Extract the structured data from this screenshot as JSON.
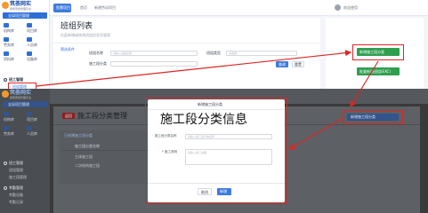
{
  "top": {
    "brand": {
      "name": "筑荟网实",
      "subtitle": "建筑劳务管理平台"
    },
    "platform_button": "全局项目管理",
    "nav_items": [
      {
        "label": "机构库",
        "icon": "building-icon"
      },
      {
        "label": "项目库",
        "icon": "folder-icon"
      },
      {
        "label": "劳务库",
        "icon": "worker-icon"
      },
      {
        "label": "人员库",
        "icon": "people-icon"
      },
      {
        "label": "资料库",
        "icon": "document-icon"
      },
      {
        "label": "设备库",
        "icon": "device-icon"
      }
    ],
    "group_heading": "班工管理",
    "group_subitem": "班组管理",
    "tabs": [
      "智慧项目",
      "首页",
      "新建劳动项目"
    ],
    "page_title": "班组列表",
    "page_desc": "在此新增或修改班组信息及管理",
    "filter_title": "筛选条件",
    "fields": {
      "team_name_label": "班组名称",
      "team_name_placeholder": "请输入班组名称",
      "team_type_label": "班组类型",
      "team_type_placeholder": "请选择",
      "work_type_label": "施工段分类"
    },
    "query_button": "查询",
    "reset_button": "重置",
    "add_group_button": "新增施工段分类",
    "import_button": "批量新增班组(EXC)"
  },
  "bottom": {
    "brand": {
      "name": "筑荟网实",
      "subtitle": "建筑劳务管理平台"
    },
    "platform_button": "全局项目管理",
    "nav_items": [
      {
        "label": "机构库",
        "icon": "building-icon"
      },
      {
        "label": "项目库",
        "icon": "folder-icon"
      },
      {
        "label": "劳务库",
        "icon": "worker-icon"
      },
      {
        "label": "人员库",
        "icon": "people-icon"
      }
    ],
    "group_heading": "班工管理",
    "group_subitems": [
      "班组管理",
      "施工段管理"
    ],
    "group2_heading": "考勤管理",
    "group2_subitems": [
      "考勤设备",
      "考勤记录"
    ],
    "page_title": "施工段分类管理",
    "page_badge": "返回",
    "add_button": "新增施工段分类",
    "table_title": "已创建施工段分类",
    "table_headers": [
      "施工段分类名称",
      "施工段分类名称"
    ],
    "table_rows": [
      [
        "主体施工段",
        "说明内容"
      ],
      [
        "二次结构施工段",
        "说明内容"
      ]
    ],
    "modal": {
      "title": "新增施工段分类",
      "overlay_text": "施工段分类信息",
      "field1_label": "施工段分类名称",
      "field1_placeholder": "请输入施工段分类名称",
      "field2_label": "* 施工说明",
      "field2_placeholder": "请输入施工说明",
      "cancel": "取消",
      "confirm": "新增"
    }
  },
  "colors": {
    "sidebar_blue": "#2f6fd6",
    "accent_blue": "#3d7bdc",
    "highlight_red": "#e02424",
    "green_button": "#2e9e4f",
    "brand_orange": "#f29a2e"
  }
}
